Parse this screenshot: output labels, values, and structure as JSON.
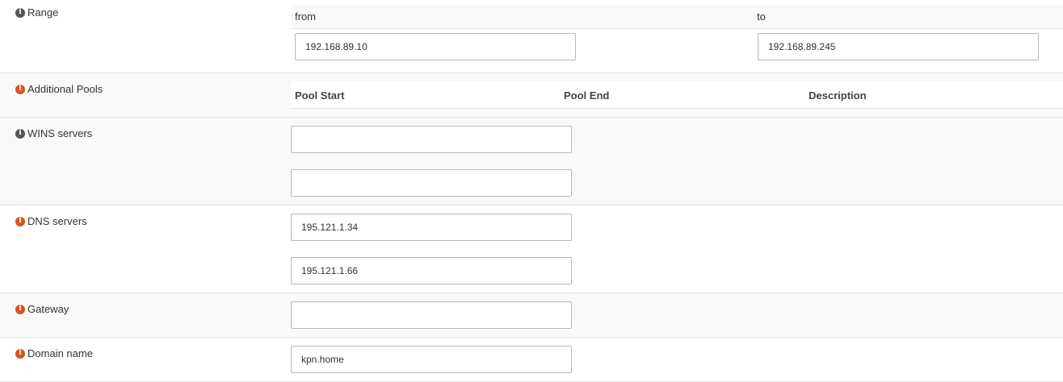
{
  "range": {
    "label": "Range",
    "from_header": "from",
    "to_header": "to",
    "from_value": "192.168.89.10",
    "to_value": "192.168.89.245"
  },
  "additional_pools": {
    "label": "Additional Pools",
    "columns": [
      "Pool Start",
      "Pool End",
      "Description"
    ]
  },
  "wins": {
    "label": "WINS servers",
    "values": [
      "",
      ""
    ]
  },
  "dns": {
    "label": "DNS servers",
    "values": [
      "195.121.1.34",
      "195.121.1.66"
    ]
  },
  "gateway": {
    "label": "Gateway",
    "value": ""
  },
  "domain": {
    "label": "Domain name",
    "value": "kpn.home"
  },
  "icons": {
    "info": "info-icon",
    "info_glyph": "i"
  },
  "colors": {
    "info_grey": "#555555",
    "info_orange": "#d9531e"
  }
}
